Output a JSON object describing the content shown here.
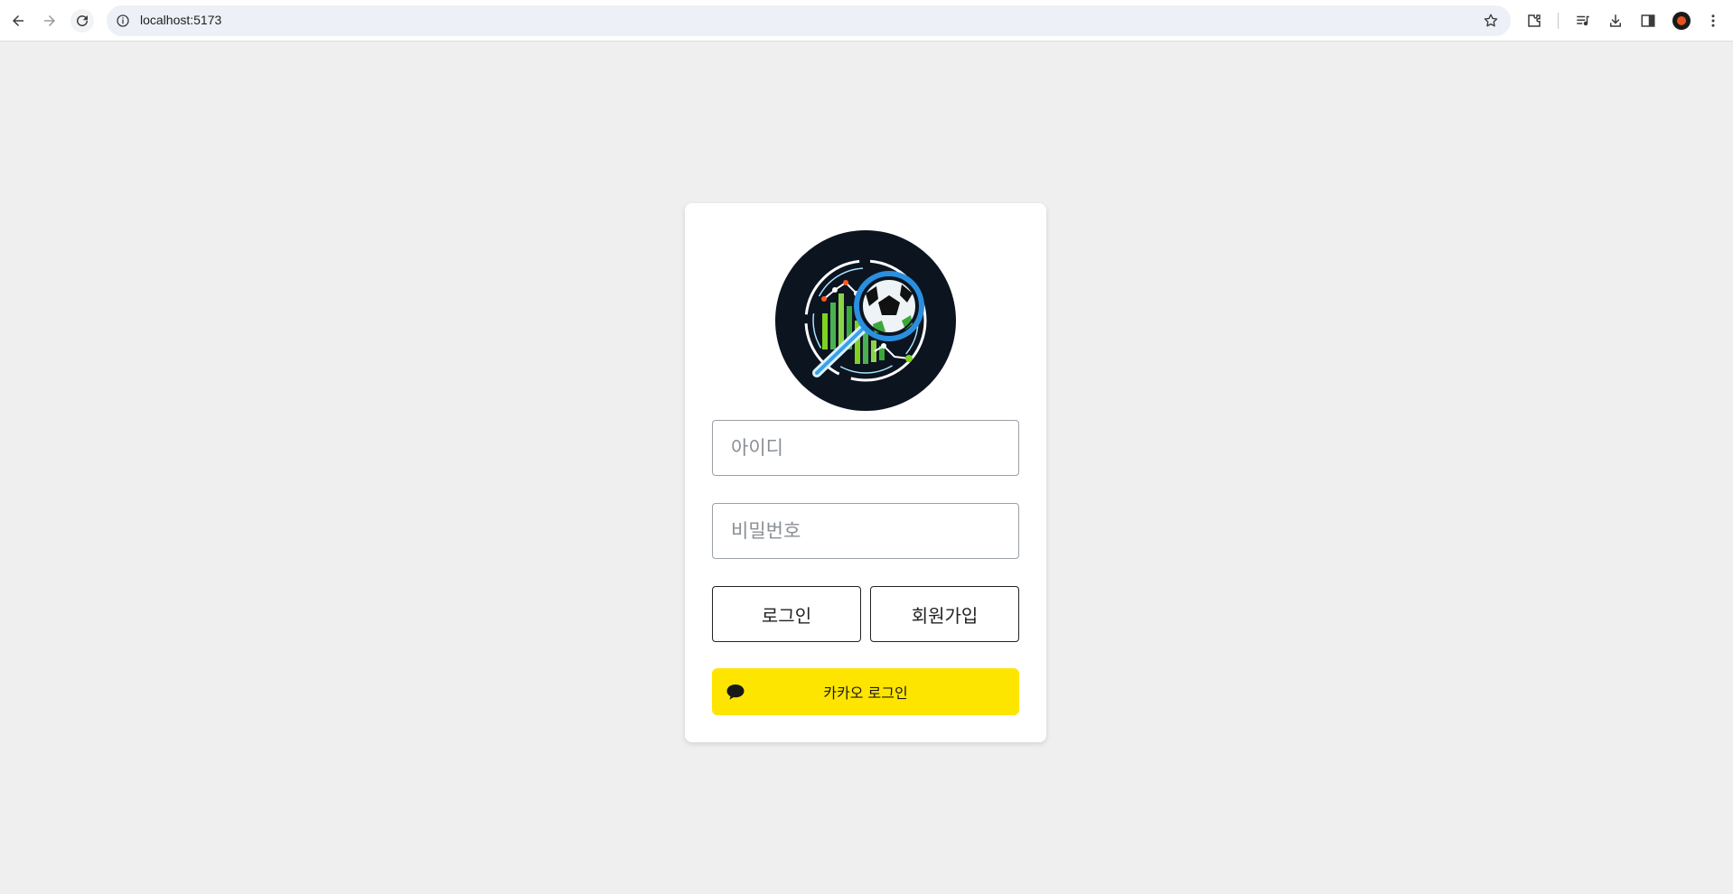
{
  "browser": {
    "url": "localhost:5173"
  },
  "login": {
    "id_placeholder": "아이디",
    "password_placeholder": "비밀번호",
    "login_label": "로그인",
    "signup_label": "회원가입",
    "kakao_label": "카카오 로그인"
  },
  "colors": {
    "page_bg": "#efefef",
    "kakao_yellow": "#fee500",
    "logo_bg": "#0c1420"
  },
  "icons": {
    "back": "arrow-left-icon",
    "forward": "arrow-right-icon",
    "reload": "reload-icon",
    "info": "info-icon",
    "bookmark": "star-icon",
    "extensions": "puzzle-icon",
    "media": "media-playlist-icon",
    "download": "download-icon",
    "side_panel": "side-panel-icon",
    "menu": "kebab-menu-icon",
    "kakao": "speech-bubble-icon"
  }
}
